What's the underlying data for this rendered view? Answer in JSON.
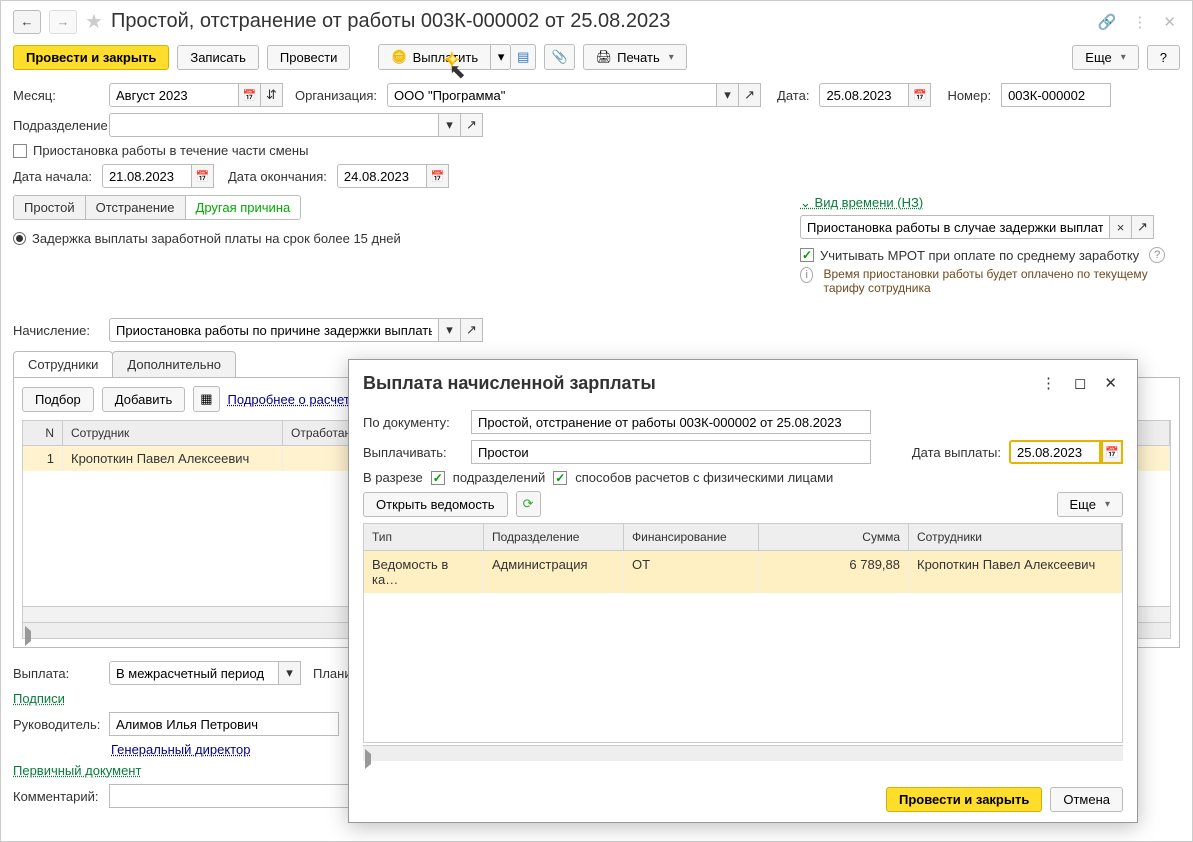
{
  "header": {
    "title": "Простой, отстранение от работы 003К-000002 от 25.08.2023"
  },
  "toolbar": {
    "post_close": "Провести и закрыть",
    "save": "Записать",
    "post": "Провести",
    "pay": "Выплатить",
    "print": "Печать",
    "more": "Еще",
    "help": "?"
  },
  "form": {
    "month_lbl": "Месяц:",
    "month_val": "Август 2023",
    "org_lbl": "Организация:",
    "org_val": "ООО \"Программа\"",
    "date_lbl": "Дата:",
    "date_val": "25.08.2023",
    "num_lbl": "Номер:",
    "num_val": "003К-000002",
    "dept_lbl": "Подразделение:",
    "dept_val": "",
    "partshift": "Приостановка работы в течение части смены",
    "date_start_lbl": "Дата начала:",
    "date_start_val": "21.08.2023",
    "date_end_lbl": "Дата окончания:",
    "date_end_val": "24.08.2023",
    "tabs": {
      "t1": "Простой",
      "t2": "Отстранение",
      "t3": "Другая причина"
    },
    "reason_radio": "Задержка выплаты заработной платы на срок более 15 дней",
    "timetype_header": "Вид времени (НЗ)",
    "timetype_val": "Приостановка работы в случае задержки выплаты з/п …",
    "mrot_check": "Учитывать МРОТ при оплате по среднему заработку",
    "info_note": "Время приостановки работы будет оплачено по текущему тарифу сотрудника",
    "accrual_lbl": "Начисление:",
    "accrual_val": "Приостановка работы по причине задержки выплаты зар"
  },
  "section_tabs": {
    "t1": "Сотрудники",
    "t2": "Дополнительно"
  },
  "panel_tb": {
    "select": "Подбор",
    "add": "Добавить",
    "details": "Подробнее о расчете"
  },
  "grid": {
    "cols": {
      "n": "N",
      "emp": "Сотрудник",
      "worked": "Отработан"
    },
    "row1": {
      "n": "1",
      "emp": "Кропоткин Павел Алексеевич"
    }
  },
  "bottom": {
    "payout_lbl": "Выплата:",
    "payout_val": "В межрасчетный период",
    "plan_lbl": "Планир",
    "signs": "Подписи",
    "mgr_lbl": "Руководитель:",
    "mgr_val": "Алимов Илья Петрович",
    "mgr_pos": "Генеральный директор",
    "primary_doc": "Первичный документ",
    "comment_lbl": "Комментарий:"
  },
  "modal": {
    "title": "Выплата начисленной зарплаты",
    "doc_lbl": "По документу:",
    "doc_val": "Простой, отстранение от работы 003К-000002 от 25.08.2023",
    "paywhat_lbl": "Выплачивать:",
    "paywhat_val": "Простои",
    "paydate_lbl": "Дата выплаты:",
    "paydate_val": "25.08.2023",
    "split_lbl": "В разрезе",
    "split_dept": "подразделений",
    "split_method": "способов расчетов с физическими лицами",
    "open_sheet": "Открыть ведомость",
    "more": "Еще",
    "cols": {
      "type": "Тип",
      "dept": "Подразделение",
      "fin": "Финансирование",
      "sum": "Сумма",
      "emp": "Сотрудники"
    },
    "row": {
      "type": "Ведомость в ка…",
      "dept": "Администрация",
      "fin": "ОТ",
      "sum": "6 789,88",
      "emp": "Кропоткин Павел Алексеевич"
    },
    "ok": "Провести и закрыть",
    "cancel": "Отмена"
  }
}
